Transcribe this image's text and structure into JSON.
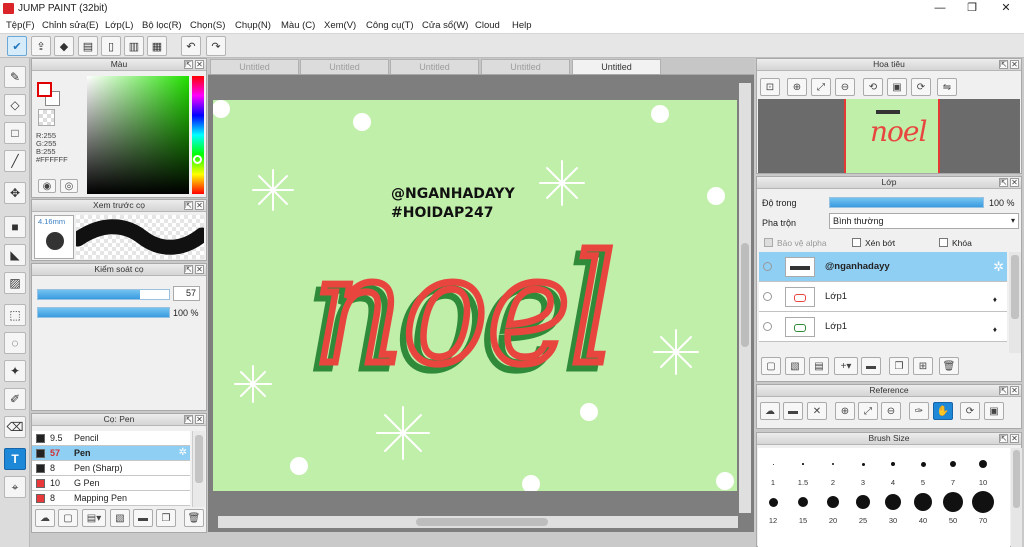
{
  "app": {
    "title": "JUMP PAINT (32bit)"
  },
  "window_controls": {
    "minimize": "—",
    "maximize": "❐",
    "close": "✕"
  },
  "menu": [
    "Tệp(F)",
    "Chỉnh sửa(E)",
    "Lớp(L)",
    "Bộ lọc(R)",
    "Chọn(S)",
    "Chụp(N)",
    "Màu (C)",
    "Xem(V)",
    "Công cụ(T)",
    "Cửa sổ(W)",
    "Cloud",
    "Help"
  ],
  "toolbar_icons": [
    "check-icon",
    "share-icon",
    "chat-icon",
    "comic-icon",
    "page-icon",
    "layout-icon",
    "grid-icon",
    "undo-icon",
    "redo-icon"
  ],
  "color_panel": {
    "title": "Màu",
    "r": "R:255",
    "g": "G:255",
    "b": "B:255",
    "hex": "#FFFFFF",
    "foreground": "#FF0000",
    "background": "#FFFFFF"
  },
  "brush_preview": {
    "title": "Xem trước cọ",
    "size": "4.16mm"
  },
  "brush_control": {
    "title": "Kiểm soát cọ",
    "size_value": "57",
    "size_fraction": 0.78,
    "opacity_value": "100 %",
    "opacity_fraction": 1.0
  },
  "brush_list": {
    "title": "Cọ: Pen",
    "items": [
      {
        "size": "9.5",
        "name": "Pencil",
        "color": "#222222",
        "selected": false
      },
      {
        "size": "57",
        "name": "Pen",
        "color": "#222222",
        "selected": true
      },
      {
        "size": "8",
        "name": "Pen (Sharp)",
        "color": "#222222",
        "selected": false
      },
      {
        "size": "10",
        "name": "G Pen",
        "color": "#e8383a",
        "selected": false
      },
      {
        "size": "8",
        "name": "Mapping Pen",
        "color": "#e8383a",
        "selected": false
      }
    ]
  },
  "doc_tabs": [
    {
      "label": "Untitled",
      "active": false
    },
    {
      "label": "Untitled",
      "active": false
    },
    {
      "label": "Untitled",
      "active": false
    },
    {
      "label": "Untitled",
      "active": false
    },
    {
      "label": "Untitled",
      "active": true
    }
  ],
  "canvas": {
    "background": "#c0efaa",
    "line1": "@NGANHADAYY",
    "line2": "#HOIDAP247",
    "word": "noel",
    "stroke_color": "#e8453f",
    "shadow_color": "#2f8a3a"
  },
  "navigator": {
    "title": "Hoa tiêu",
    "thumb_text": "noel"
  },
  "layers": {
    "title": "Lớp",
    "opacity_label": "Độ trong",
    "opacity_value": "100 %",
    "opacity_fraction": 1.0,
    "blend_label": "Pha trộn",
    "blend_value": "Bình thường",
    "protect_alpha": "Bảo vệ alpha",
    "clipping": "Xén bớt",
    "lock": "Khóa",
    "items": [
      {
        "name": "@nganhadayy",
        "selected": true
      },
      {
        "name": "Lớp1",
        "selected": false
      },
      {
        "name": "Lớp1",
        "selected": false
      }
    ]
  },
  "reference": {
    "title": "Reference"
  },
  "brush_size": {
    "title": "Brush Size",
    "row1": [
      "1",
      "1.5",
      "2",
      "3",
      "4",
      "5",
      "7",
      "10"
    ],
    "row2": [
      "12",
      "15",
      "20",
      "25",
      "30",
      "40",
      "50",
      "70"
    ]
  }
}
